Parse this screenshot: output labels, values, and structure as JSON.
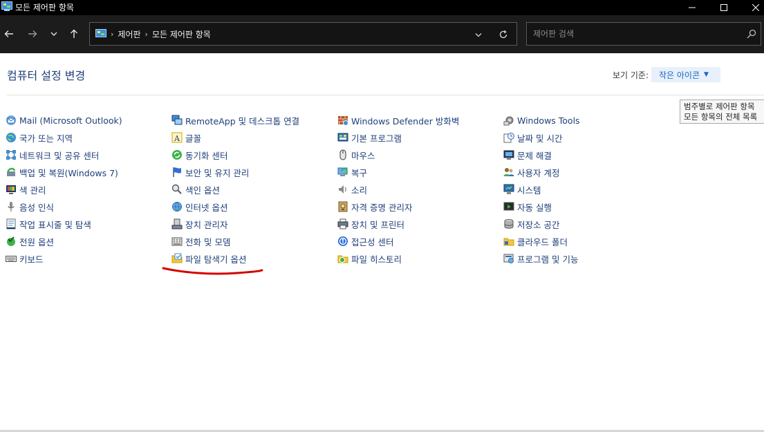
{
  "window": {
    "title": "모든 제어판 항목"
  },
  "nav": {
    "breadcrumbs": [
      "제어판",
      "모든 제어판 항목"
    ],
    "search_placeholder": "제어판 검색"
  },
  "header": {
    "title": "컴퓨터 설정 변경",
    "view_label": "보기 기준:",
    "view_value": "작은 아이콘"
  },
  "tooltip": {
    "lines": [
      "범주별로 제어판 항목",
      "모든 항목의 전체 목록"
    ]
  },
  "columns": [
    [
      {
        "label": "Mail (Microsoft Outlook)",
        "icon": "mail-icon"
      },
      {
        "label": "국가 또는 지역",
        "icon": "globe-icon"
      },
      {
        "label": "네트워크 및 공유 센터",
        "icon": "network-icon"
      },
      {
        "label": "백업 및 복원(Windows 7)",
        "icon": "backup-icon"
      },
      {
        "label": "색 관리",
        "icon": "color-management-icon"
      },
      {
        "label": "음성 인식",
        "icon": "microphone-icon"
      },
      {
        "label": "작업 표시줄 및 탐색",
        "icon": "taskbar-icon"
      },
      {
        "label": "전원 옵션",
        "icon": "power-icon"
      },
      {
        "label": "키보드",
        "icon": "keyboard-icon"
      }
    ],
    [
      {
        "label": "RemoteApp 및 데스크톱 연결",
        "icon": "remoteapp-icon"
      },
      {
        "label": "글꼴",
        "icon": "font-icon"
      },
      {
        "label": "동기화 센터",
        "icon": "sync-icon"
      },
      {
        "label": "보안 및 유지 관리",
        "icon": "flag-icon"
      },
      {
        "label": "색인 옵션",
        "icon": "indexing-icon"
      },
      {
        "label": "인터넷 옵션",
        "icon": "internet-icon"
      },
      {
        "label": "장치 관리자",
        "icon": "device-manager-icon"
      },
      {
        "label": "전화 및 모뎀",
        "icon": "phone-modem-icon"
      },
      {
        "label": "파일 탐색기 옵션",
        "icon": "folder-options-icon"
      }
    ],
    [
      {
        "label": "Windows Defender 방화벽",
        "icon": "firewall-icon"
      },
      {
        "label": "기본 프로그램",
        "icon": "default-programs-icon"
      },
      {
        "label": "마우스",
        "icon": "mouse-icon"
      },
      {
        "label": "복구",
        "icon": "recovery-icon"
      },
      {
        "label": "소리",
        "icon": "sound-icon"
      },
      {
        "label": "자격 증명 관리자",
        "icon": "credential-icon"
      },
      {
        "label": "장치 및 프린터",
        "icon": "printer-icon"
      },
      {
        "label": "접근성 센터",
        "icon": "accessibility-icon"
      },
      {
        "label": "파일 히스토리",
        "icon": "file-history-icon"
      }
    ],
    [
      {
        "label": "Windows Tools",
        "icon": "tools-icon"
      },
      {
        "label": "날짜 및 시간",
        "icon": "clock-icon"
      },
      {
        "label": "문제 해결",
        "icon": "troubleshoot-icon"
      },
      {
        "label": "사용자 계정",
        "icon": "user-accounts-icon"
      },
      {
        "label": "시스템",
        "icon": "system-icon"
      },
      {
        "label": "자동 실행",
        "icon": "autoplay-icon"
      },
      {
        "label": "저장소 공간",
        "icon": "storage-icon"
      },
      {
        "label": "클라우드 폴더",
        "icon": "cloud-folder-icon"
      },
      {
        "label": "프로그램 및 기능",
        "icon": "programs-icon"
      }
    ]
  ],
  "colors": {
    "titlebar": "#000000",
    "navbar": "#1c1c1c",
    "link": "#1f3f7a",
    "view_accent": "#1a66c2",
    "annotation": "#d40000"
  }
}
